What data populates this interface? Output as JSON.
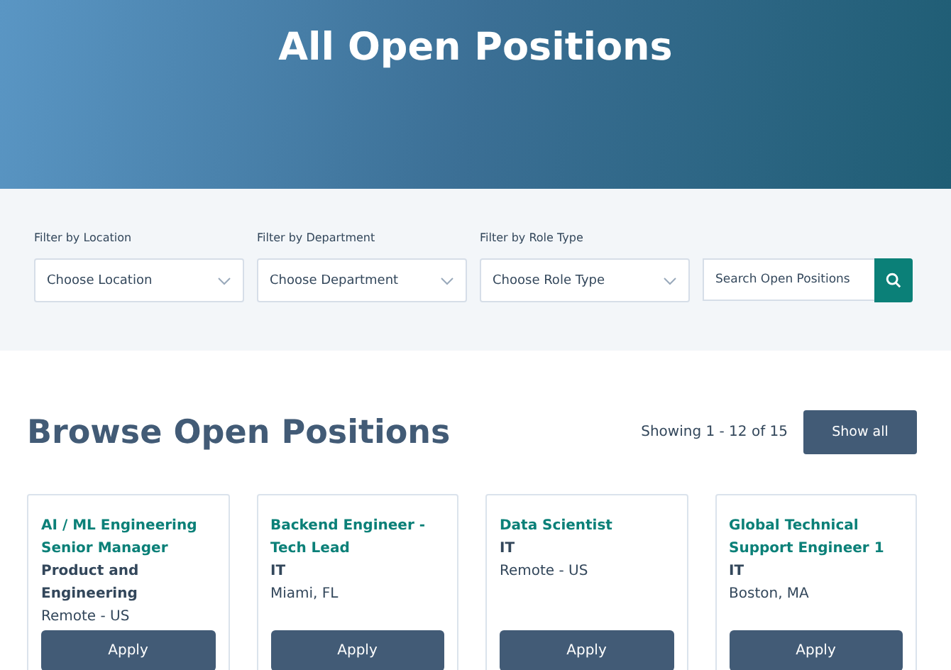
{
  "hero": {
    "title": "All Open Positions"
  },
  "filters": [
    {
      "label": "Filter by Location",
      "value": "Choose Location"
    },
    {
      "label": "Filter by Department",
      "value": "Choose Department"
    },
    {
      "label": "Filter by Role Type",
      "value": "Choose Role Type"
    }
  ],
  "search": {
    "placeholder": "Search Open Positions"
  },
  "browse": {
    "title": "Browse Open Positions",
    "count": "Showing 1 - 12 of 15",
    "button": "Show all"
  },
  "jobs": [
    {
      "title": "AI / ML Engineering Senior Manager",
      "department": "Product and Engineering",
      "location": "Remote - US",
      "button": "Apply"
    },
    {
      "title": "Backend Engineer - Tech Lead",
      "department": "IT",
      "location": "Miami, FL",
      "button": "Apply"
    },
    {
      "title": "Data Scientist",
      "department": "IT",
      "location": "Remote - US",
      "button": "Apply"
    },
    {
      "title": "Global Technical Support Engineer 1",
      "department": "IT",
      "location": "Boston, MA",
      "button": "Apply"
    }
  ]
}
